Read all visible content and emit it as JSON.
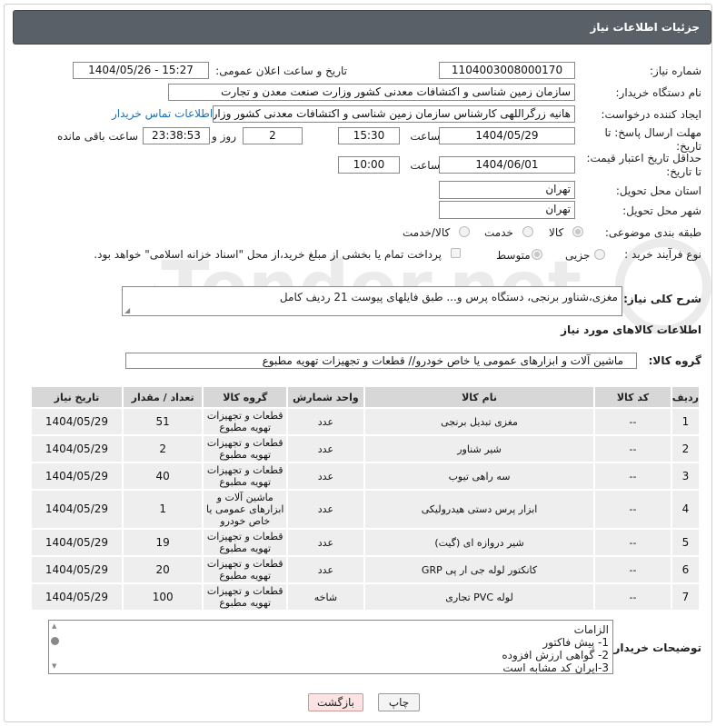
{
  "header": {
    "title": "جزئیات اطلاعات نیاز"
  },
  "form": {
    "need_number_label": "شماره نیاز:",
    "need_number": "1104003008000170",
    "announce_label": "تاریخ و ساعت اعلان عمومی:",
    "announce_value": "1404/05/26 - 15:27",
    "buyer_org_label": "نام دستگاه خریدار:",
    "buyer_org": "سازمان زمین شناسی و اکتشافات معدنی کشور وزارت صنعت معدن و تجارت",
    "creator_label": "ایجاد کننده درخواست:",
    "creator": "هانیه زرگراللهی کارشناس سازمان زمین شناسی و اکتشافات معدنی کشور وزارت",
    "contact_link": "اطلاعات تماس خریدار",
    "deadline_label": "مهلت ارسال پاسخ: تا تاریخ:",
    "deadline_date": "1404/05/29",
    "time_label": "ساعت",
    "deadline_time": "15:30",
    "days_value": "2",
    "days_label": "روز و",
    "remaining_time": "23:38:53",
    "remaining_label": "ساعت باقی مانده",
    "validity_label": "حداقل تاریخ اعتبار قیمت: تا تاریخ:",
    "validity_date": "1404/06/01",
    "validity_time": "10:00",
    "province_label": "استان محل تحویل:",
    "province": "تهران",
    "city_label": "شهر محل تحویل:",
    "city": "تهران",
    "category_label": "طبقه بندی موضوعی:",
    "category_options": [
      "کالا",
      "خدمت",
      "کالا/خدمت"
    ],
    "process_label": "نوع فرآیند خرید :",
    "process_options": [
      "جزیی",
      "متوسط"
    ],
    "payment_note": "پرداخت تمام یا بخشی از مبلغ خرید،از محل \"اسناد خزانه اسلامی\" خواهد بود.",
    "description_label": "شرح کلی نیاز:",
    "description": "مغزی،شناور برنجی، دستگاه پرس و... طبق فایلهای پیوست 21 ردیف کامل"
  },
  "goods": {
    "section_title": "اطلاعات کالاهای مورد نیاز",
    "group_label": "گروه کالا:",
    "group_value": "ماشین آلات و ابزارهای عمومی یا خاص خودرو//  قطعات و تجهیزات تهویه مطبوع",
    "columns": [
      "ردیف",
      "کد کالا",
      "نام کالا",
      "واحد شمارش",
      "گروه کالا",
      "تعداد / مقدار",
      "تاریخ نیاز"
    ],
    "rows": [
      [
        "1",
        "--",
        "مغزی تبدیل برنجی",
        "عدد",
        "قطعات و تجهیزات تهویه مطبوع",
        "51",
        "1404/05/29"
      ],
      [
        "2",
        "--",
        "شیر شناور",
        "عدد",
        "قطعات و تجهیزات تهویه مطبوع",
        "2",
        "1404/05/29"
      ],
      [
        "3",
        "--",
        "سه راهی تیوب",
        "عدد",
        "قطعات و تجهیزات تهویه مطبوع",
        "40",
        "1404/05/29"
      ],
      [
        "4",
        "--",
        "ابزار پرس دستی هیدرولیکی",
        "عدد",
        "ماشین آلات و ابزارهای عمومی یا خاص خودرو",
        "1",
        "1404/05/29"
      ],
      [
        "5",
        "--",
        "شیر دروازه ای (گیت)",
        "عدد",
        "قطعات و تجهیزات تهویه مطبوع",
        "19",
        "1404/05/29"
      ],
      [
        "6",
        "--",
        "کانکتور لوله جی ار پی GRP",
        "عدد",
        "قطعات و تجهیزات تهویه مطبوع",
        "20",
        "1404/05/29"
      ],
      [
        "7",
        "--",
        "لوله PVC تجاری",
        "شاخه",
        "قطعات و تجهیزات تهویه مطبوع",
        "100",
        "1404/05/29"
      ]
    ]
  },
  "buyer_notes": {
    "label": "توضیحات خریدار:",
    "lines": [
      "الزامات",
      "1-  پیش فاکتور",
      "2- گواهی ارزش افزوده",
      "3-ایران کد مشابه است"
    ]
  },
  "buttons": {
    "print": "چاپ",
    "back": "بازگشت"
  },
  "watermark_text": "AriaTender.net",
  "colors": {
    "header_bg": "#5a6068",
    "link": "#1e6fb8",
    "back_button_bg": "#fbe3e3"
  }
}
